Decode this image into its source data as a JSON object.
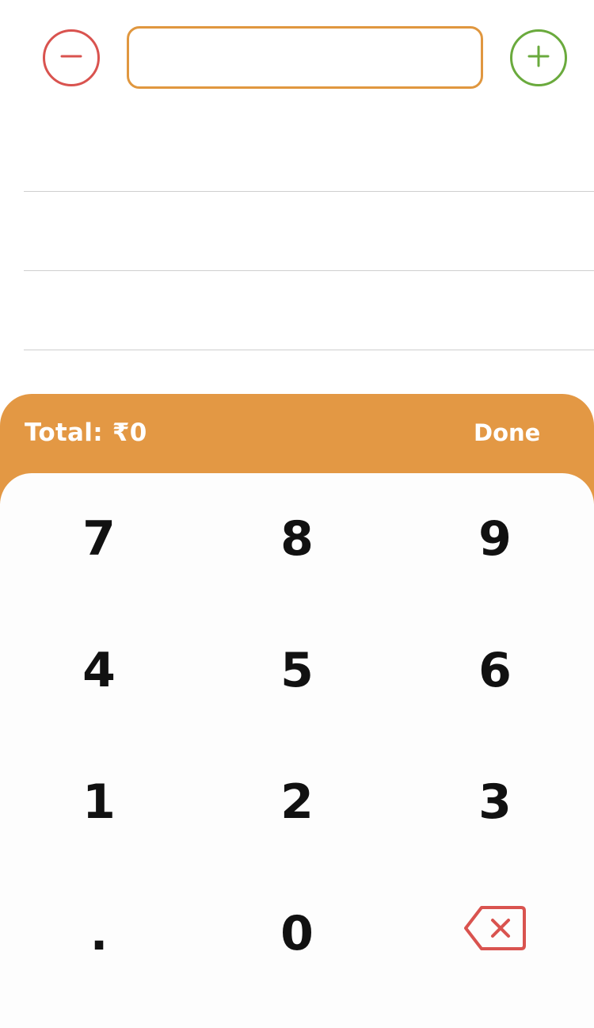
{
  "controls": {
    "decrement_icon": "minus-circle-icon",
    "increment_icon": "plus-circle-icon",
    "amount_value": "",
    "amount_placeholder": ""
  },
  "summary": {
    "total_label": "Total:",
    "total_value": "₹0",
    "done_label": "Done"
  },
  "keypad": {
    "keys": [
      "7",
      "8",
      "9",
      "4",
      "5",
      "6",
      "1",
      "2",
      "3",
      ".",
      "0"
    ],
    "backspace_icon": "backspace-icon"
  },
  "colors": {
    "accent": "#e39844",
    "decrement": "#d9534f",
    "increment": "#6aaa3d",
    "backspace": "#d9534f"
  }
}
